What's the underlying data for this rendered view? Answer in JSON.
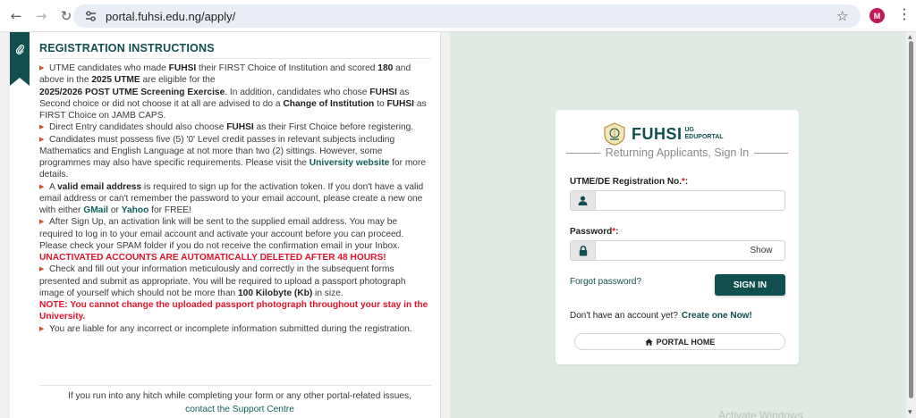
{
  "browser": {
    "url": "portal.fuhsi.edu.ng/apply/",
    "profile_initial": "M"
  },
  "instructions": {
    "title": "REGISTRATION INSTRUCTIONS",
    "p1": {
      "a": "UTME candidates who made ",
      "b": "FUHSI",
      "c": " their FIRST Choice of Institution and scored ",
      "d": "180",
      "e": " and above in the ",
      "f": "2025 UTME",
      "g": " are eligible for the ",
      "h": "2025/2026 POST UTME Screening Exercise",
      "i": ". In addition, candidates who chose ",
      "j": "FUHSI",
      "k": " as Second choice or did not choose it at all are advised to do a ",
      "l": "Change of Institution",
      "m": " to ",
      "n": "FUHSI",
      "o": " as FIRST Choice on JAMB CAPS."
    },
    "p2": {
      "a": "Direct Entry candidates should also choose ",
      "b": "FUHSI",
      "c": " as their First Choice before registering."
    },
    "p3": {
      "a": "Candidates must possess five (5) '0' Level credit passes in relevant subjects including Mathematics and English Language at not more than two (2) sittings. However, some programmes may also have specific requirements. Please visit the ",
      "b": "University website",
      "c": " for more details."
    },
    "p4": {
      "a": "A ",
      "b": "valid email address",
      "c": " is required to sign up for the activation token. If you don't have a valid email address or can't remember the password to your email account, please create a new one with either ",
      "d": "GMail",
      "e": " or ",
      "f": "Yahoo",
      "g": " for FREE!"
    },
    "p5": {
      "a": "After Sign Up, an activation link will be sent to the supplied email address. You may be required to log in to your email account and activate your account before you can proceed. Please check your SPAM folder if you do not receive the confirmation email in your Inbox. ",
      "b": "UNACTIVATED ACCOUNTS ARE AUTOMATICALLY DELETED AFTER 48 HOURS!"
    },
    "p6": {
      "a": "Check and fill out your information meticulously and correctly in the subsequent forms presented and submit as appropriate. You will be required to upload a passport photograph image of yourself which should not be more than ",
      "b": "100 Kilobyte (Kb)",
      "c": " in size.",
      "d": "NOTE: You cannot change the uploaded passport photograph throughout your stay in the University."
    },
    "p7": {
      "a": "You are liable for any incorrect or incomplete information submitted during the registration."
    },
    "hitch_text": "If you run into any hitch while completing your form or any other portal-related issues,",
    "support_link": "contact the Support Centre"
  },
  "signin": {
    "brand": "FUHSI",
    "brand_sub_1": "UG",
    "brand_sub_2": "EDUPORTAL",
    "subtitle": "Returning Applicants, Sign In",
    "reg_label": "UTME/DE Registration No.",
    "reg_value": "",
    "password_label": "Password",
    "password_value": "",
    "required_mark": "*",
    "colon": ":",
    "show_label": "Show",
    "forgot_label": "Forgot password?",
    "signin_label": "SIGN IN",
    "no_account_text": "Don't have an account yet?",
    "create_label": "Create one Now!",
    "portal_home_label": "PORTAL HOME"
  },
  "watermark": "Activate Windows",
  "colors": {
    "primary": "#0f4f4f",
    "danger": "#e0152a",
    "bullet": "#d24c2c",
    "right_bg": "#dfeae3"
  }
}
